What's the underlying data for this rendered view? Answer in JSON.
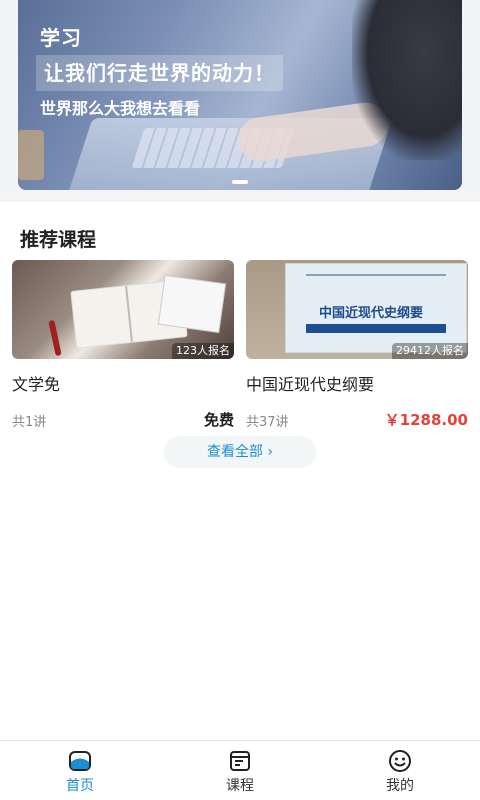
{
  "banner": {
    "tag": "学习",
    "title": "让我们行走世界的动力！",
    "subtitle": "世界那么大我想去看看"
  },
  "section": {
    "title": "推荐课程"
  },
  "courses": [
    {
      "name": "文学免",
      "enrolled": "123人报名",
      "lessons": "共1讲",
      "price": "免费"
    },
    {
      "name": "中国近现代史纲要",
      "enrolled": "29412人报名",
      "lessons": "共37讲",
      "price": "￥1288.00",
      "cover_title": "中国近现代史纲要"
    }
  ],
  "see_all": {
    "label": "查看全部 ›"
  },
  "tabbar": {
    "items": [
      {
        "label": "首页",
        "icon": "home-icon",
        "active": true
      },
      {
        "label": "课程",
        "icon": "course-icon",
        "active": false
      },
      {
        "label": "我的",
        "icon": "smiley-icon",
        "active": false
      }
    ]
  },
  "colors": {
    "accent": "#1a8fd6",
    "price_red": "#e8413a"
  }
}
